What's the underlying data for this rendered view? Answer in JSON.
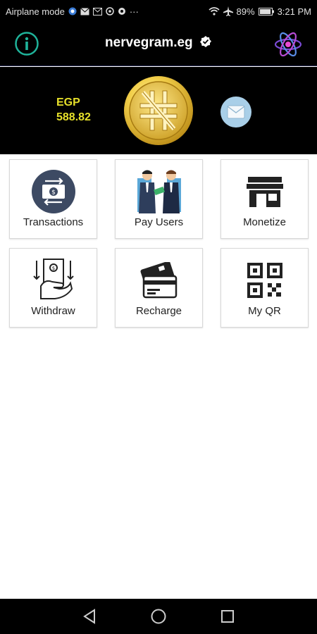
{
  "status_bar": {
    "mode": "Airplane mode",
    "battery": "89%",
    "time": "3:21 PM",
    "more": "···"
  },
  "app_bar": {
    "title": "nervegram.eg"
  },
  "balance": {
    "currency": "EGP",
    "amount": "588.82"
  },
  "tiles": [
    {
      "label": "Transactions",
      "icon": "transactions-icon"
    },
    {
      "label": "Pay Users",
      "icon": "pay-users-icon"
    },
    {
      "label": "Monetize",
      "icon": "store-icon"
    },
    {
      "label": "Withdraw",
      "icon": "withdraw-icon"
    },
    {
      "label": "Recharge",
      "icon": "credit-card-icon"
    },
    {
      "label": "My QR",
      "icon": "qr-code-icon"
    }
  ],
  "colors": {
    "balance_text": "#e6e02a",
    "info_icon": "#1fb39a",
    "atom_icon": "#7b4bd6",
    "mail_circle": "#a9cfe8"
  }
}
